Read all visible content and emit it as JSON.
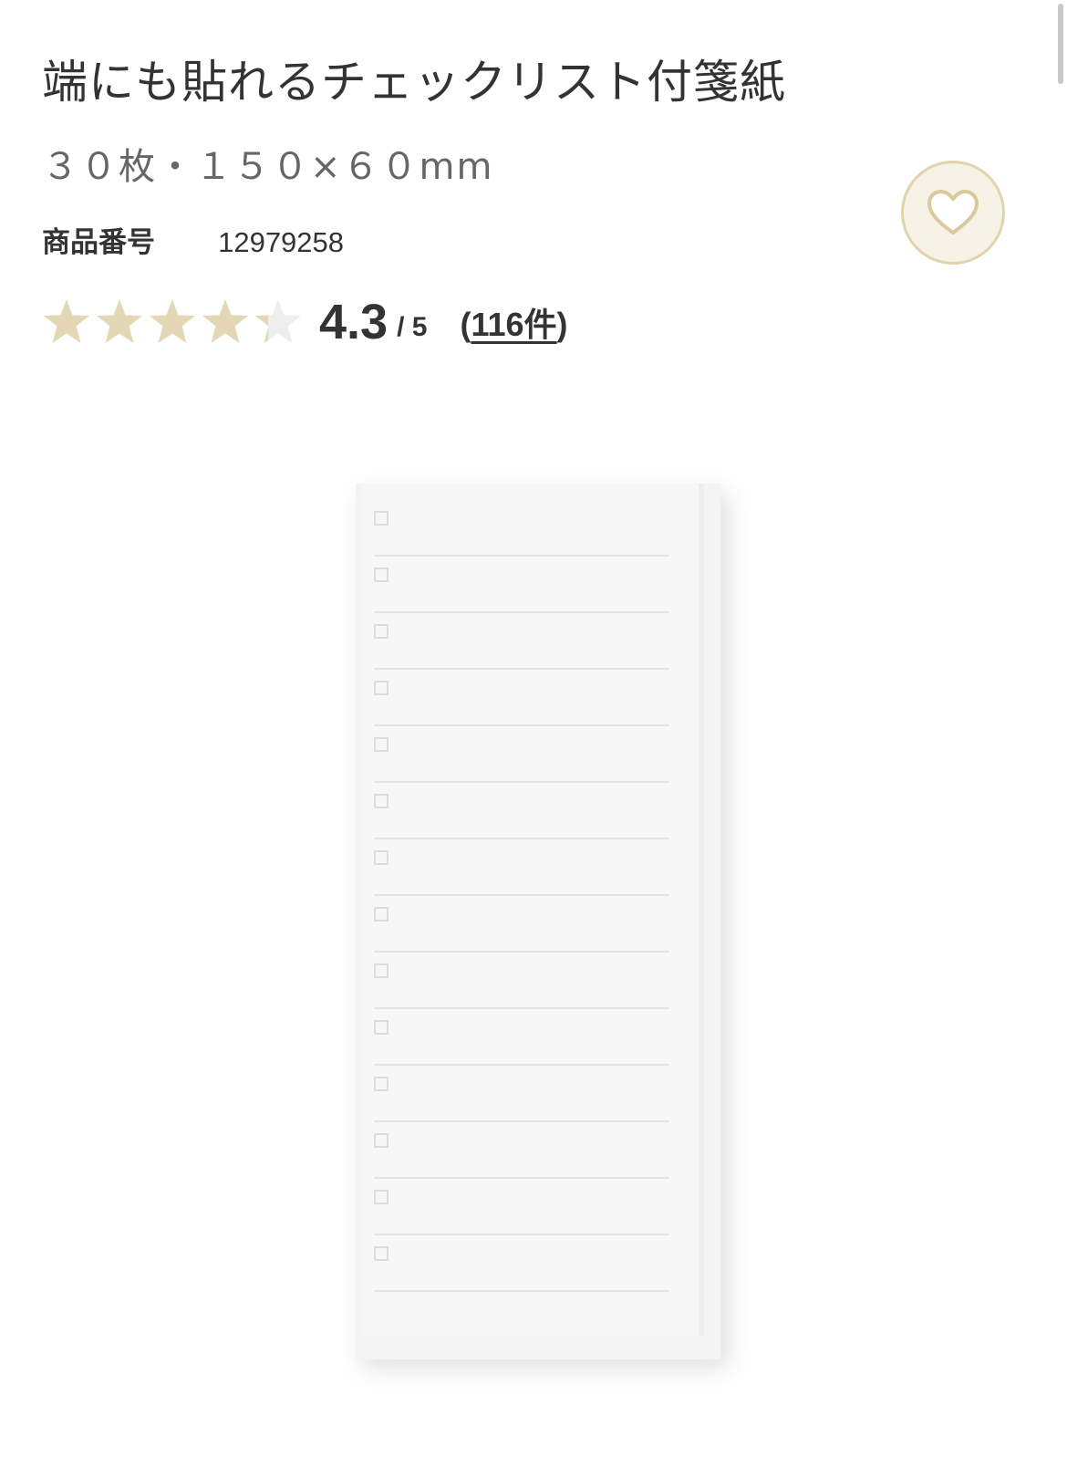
{
  "product": {
    "title": "端にも貼れるチェックリスト付箋紙",
    "spec": "３０枚・１５０×６０mm",
    "code_label": "商品番号",
    "code_value": "12979258"
  },
  "rating": {
    "score": "4.3",
    "max": "/ 5",
    "count_open": "(",
    "count": "116件",
    "count_close": ")",
    "value": 4.3,
    "stars_total": 5
  },
  "icons": {
    "favorite": "heart-icon",
    "star": "star-icon",
    "checkbox": "checkbox-icon"
  },
  "colors": {
    "star_filled": "#e3d7b5",
    "star_empty": "#eeeeee",
    "favorite_bg": "#f6f2e6",
    "favorite_border": "#e0d3ae",
    "text": "#333333",
    "subtext": "#666666"
  },
  "image": {
    "checklist_rows": 14
  }
}
